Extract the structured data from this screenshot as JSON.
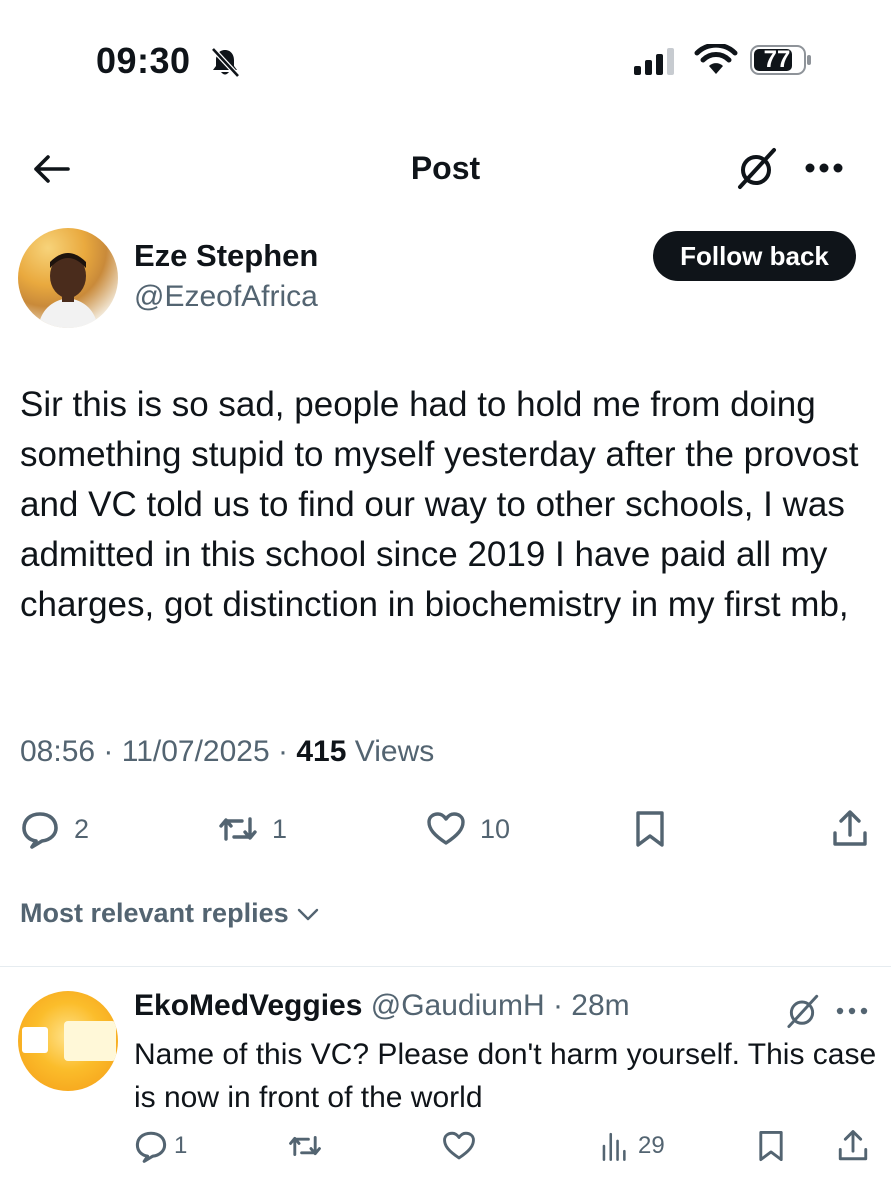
{
  "status_bar": {
    "time": "09:30",
    "battery": "77",
    "icons": [
      "bell-slash-icon",
      "cellular-signal-icon",
      "wifi-icon",
      "battery-icon"
    ]
  },
  "nav": {
    "title": "Post",
    "back_icon": "arrow-left-icon",
    "grok_icon": "grok-icon",
    "more_icon": "more-horizontal-icon"
  },
  "post": {
    "author_name": "Eze Stephen",
    "author_handle": "@EzeofAfrica",
    "follow_label": "Follow back",
    "text": "Sir this is so sad, people had to hold me from doing something stupid to myself yesterday after the provost and VC told us to find our way to other schools, I was admitted in this school since 2019 I have paid all my charges, got distinction in biochemistry in my first mb,",
    "time": "08:56",
    "date": "11/07/2025",
    "views_count": "415",
    "views_label": "Views",
    "actions": {
      "replies": "2",
      "reposts": "1",
      "likes": "10"
    }
  },
  "replies_section": {
    "sort_label": "Most relevant replies"
  },
  "reply": {
    "name": "EkoMedVeggies",
    "handle": "@GaudiumH",
    "time": "28m",
    "text": "Name of this VC? Please don't harm yourself. This case is now in front of the world",
    "actions": {
      "replies": "1",
      "views": "29"
    }
  },
  "colors": {
    "text_primary": "#0f1419",
    "text_secondary": "#536471",
    "button_bg": "#0f1419",
    "divider": "#e6ecf0"
  }
}
